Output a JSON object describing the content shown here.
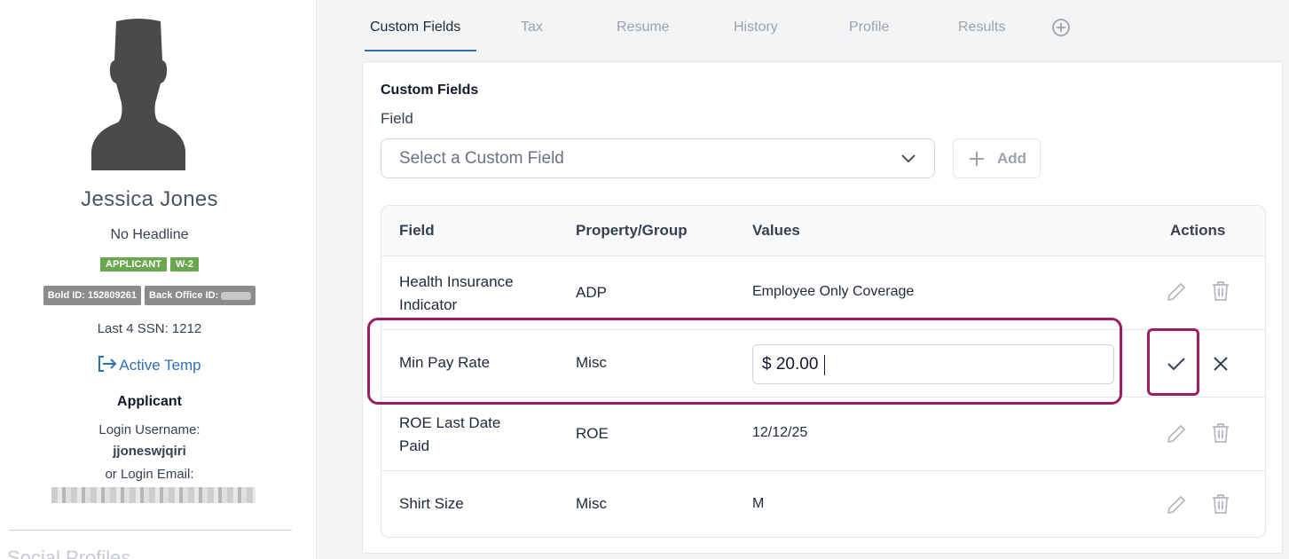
{
  "profile": {
    "name": "Jessica Jones",
    "headline": "No Headline",
    "badges": [
      "APPLICANT",
      "W-2"
    ],
    "bold_id": "Bold ID: 152809261",
    "back_office_id_label": "Back Office ID:",
    "ssn": "Last 4 SSN: 1212",
    "active_status": "Active Temp",
    "role": "Applicant",
    "login_username_label": "Login Username:",
    "login_username": "jjoneswjqiri",
    "login_email_label": "or Login Email:",
    "social_profiles_label": "Social Profiles"
  },
  "tabs": [
    {
      "label": "Custom Fields",
      "active": true
    },
    {
      "label": "Tax"
    },
    {
      "label": "Resume"
    },
    {
      "label": "History"
    },
    {
      "label": "Profile"
    },
    {
      "label": "Results"
    }
  ],
  "custom_fields": {
    "title": "Custom Fields",
    "field_label": "Field",
    "select_placeholder": "Select a Custom Field",
    "add_label": "Add",
    "columns": [
      "Field",
      "Property/Group",
      "Values",
      "Actions"
    ],
    "rows": [
      {
        "field_line1": "Health Insurance",
        "field_line2": "Indicator",
        "group": "ADP",
        "value": "Employee Only Coverage"
      },
      {
        "field": "Min Pay Rate",
        "group": "Misc",
        "value": "$ 20.00",
        "editing": true
      },
      {
        "field_line1": "ROE Last Date",
        "field_line2": "Paid",
        "group": "ROE",
        "value": "12/12/25"
      },
      {
        "field": "Shirt Size",
        "group": "Misc",
        "value": "M"
      }
    ]
  },
  "colors": {
    "accent": "#2f6fb5",
    "badge_green": "#6aa84f",
    "highlight": "#9b1f5d"
  }
}
